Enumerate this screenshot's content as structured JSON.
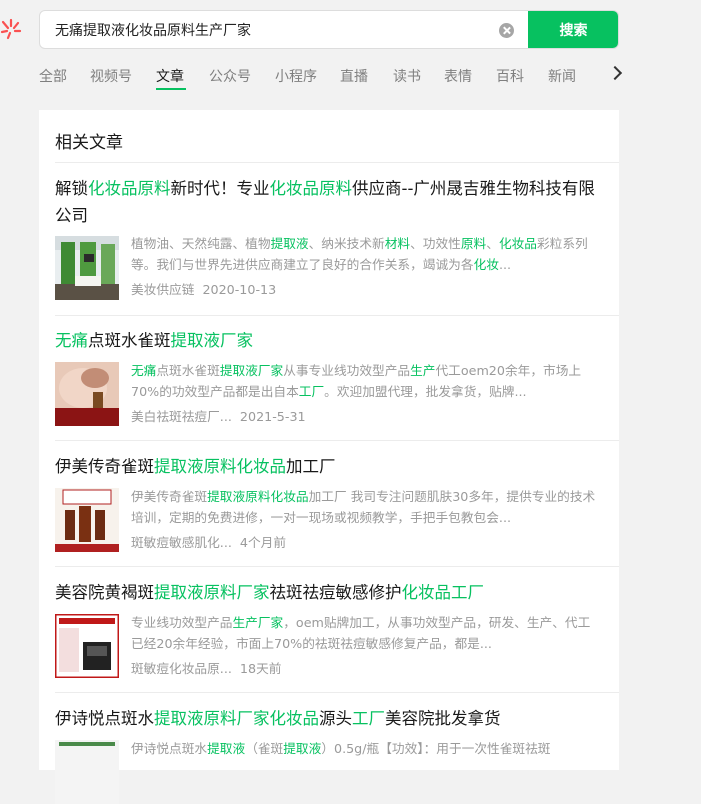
{
  "search": {
    "query": "无痛提取液化妆品原料生产厂家",
    "button_label": "搜索"
  },
  "tabs": [
    "全部",
    "视频号",
    "文章",
    "公众号",
    "小程序",
    "直播",
    "读书",
    "表情",
    "百科",
    "新闻"
  ],
  "active_tab": "文章",
  "section_title": "相关文章",
  "articles": [
    {
      "title": [
        [
          "解锁",
          0
        ],
        [
          "化妆品原料",
          1
        ],
        [
          "新时代！专业",
          0
        ],
        [
          "化妆品原料",
          1
        ],
        [
          "供应商--广州晟吉雅生物科技有限公司",
          0
        ]
      ],
      "desc": [
        [
          "植物油、天然纯露、植物",
          0
        ],
        [
          "提取液",
          1
        ],
        [
          "、纳米技术新",
          0
        ],
        [
          "材料",
          1
        ],
        [
          "、功效性",
          0
        ],
        [
          "原料",
          1
        ],
        [
          "、",
          0
        ],
        [
          "化妆品",
          1
        ],
        [
          "彩粒系列等。我们与世界先进供应商建立了良好的合作关系，竭诚为各",
          0
        ],
        [
          "化妆",
          1
        ],
        [
          "...",
          0
        ]
      ],
      "source": "美妆供应链",
      "date": "2020-10-13"
    },
    {
      "title": [
        [
          "无痛",
          1
        ],
        [
          "点斑水雀斑",
          0
        ],
        [
          "提取液厂家",
          1
        ]
      ],
      "desc": [
        [
          "无痛",
          1
        ],
        [
          "点斑水雀斑",
          0
        ],
        [
          "提取液厂家",
          1
        ],
        [
          "从事专业线功效型产品",
          0
        ],
        [
          "生产",
          1
        ],
        [
          "代工oem20余年，市场上70%的功效型产品都是出自本",
          0
        ],
        [
          "工厂",
          1
        ],
        [
          "。欢迎加盟代理，批发拿货，贴牌...",
          0
        ]
      ],
      "source": "美白祛斑祛痘厂...",
      "date": "2021-5-31"
    },
    {
      "title": [
        [
          "伊美传奇雀斑",
          0
        ],
        [
          "提取液原料化妆品",
          1
        ],
        [
          "加工厂",
          0
        ]
      ],
      "desc": [
        [
          "伊美传奇雀斑",
          0
        ],
        [
          "提取液原料化妆品",
          1
        ],
        [
          "加工厂 我司专注问题肌肤30多年，提供专业的技术培训，定期的免费进修，一对一现场或视频教学，手把手包教包会...",
          0
        ]
      ],
      "source": "斑敏痘敏感肌化...",
      "date": "4个月前"
    },
    {
      "title": [
        [
          "美容院黄褐斑",
          0
        ],
        [
          "提取液原料厂家",
          1
        ],
        [
          "祛斑祛痘敏感修护",
          0
        ],
        [
          "化妆品工厂",
          1
        ]
      ],
      "desc": [
        [
          "专业线功效型产品",
          0
        ],
        [
          "生产厂家",
          1
        ],
        [
          "，oem贴牌加工，从事功效型产品，研发、生产、代工已经20余年经验，市面上70%的祛斑祛痘敏感修复产品，都是...",
          0
        ]
      ],
      "source": "斑敏痘化妆品原...",
      "date": "18天前"
    },
    {
      "title": [
        [
          "伊诗悦点斑水",
          0
        ],
        [
          "提取液原料厂家化妆品",
          1
        ],
        [
          "源头",
          0
        ],
        [
          "工厂",
          1
        ],
        [
          "美容院批发拿货",
          0
        ]
      ],
      "desc": [
        [
          "伊诗悦点斑水",
          0
        ],
        [
          "提取液",
          1
        ],
        [
          "（雀斑",
          0
        ],
        [
          "提取液",
          1
        ],
        [
          "）0.5g/瓶【功效】：用于一次性雀斑祛斑",
          0
        ]
      ],
      "source": "",
      "date": ""
    }
  ],
  "colors": {
    "accent": "#07c160",
    "title_text": "#191919",
    "muted_text": "#9a9a9a",
    "background": "#f2f2f2",
    "logo": "#fa5151"
  },
  "icons": {
    "logo": "wechat-search-logo-icon",
    "clear": "clear-icon",
    "more": "chevron-right-icon"
  }
}
